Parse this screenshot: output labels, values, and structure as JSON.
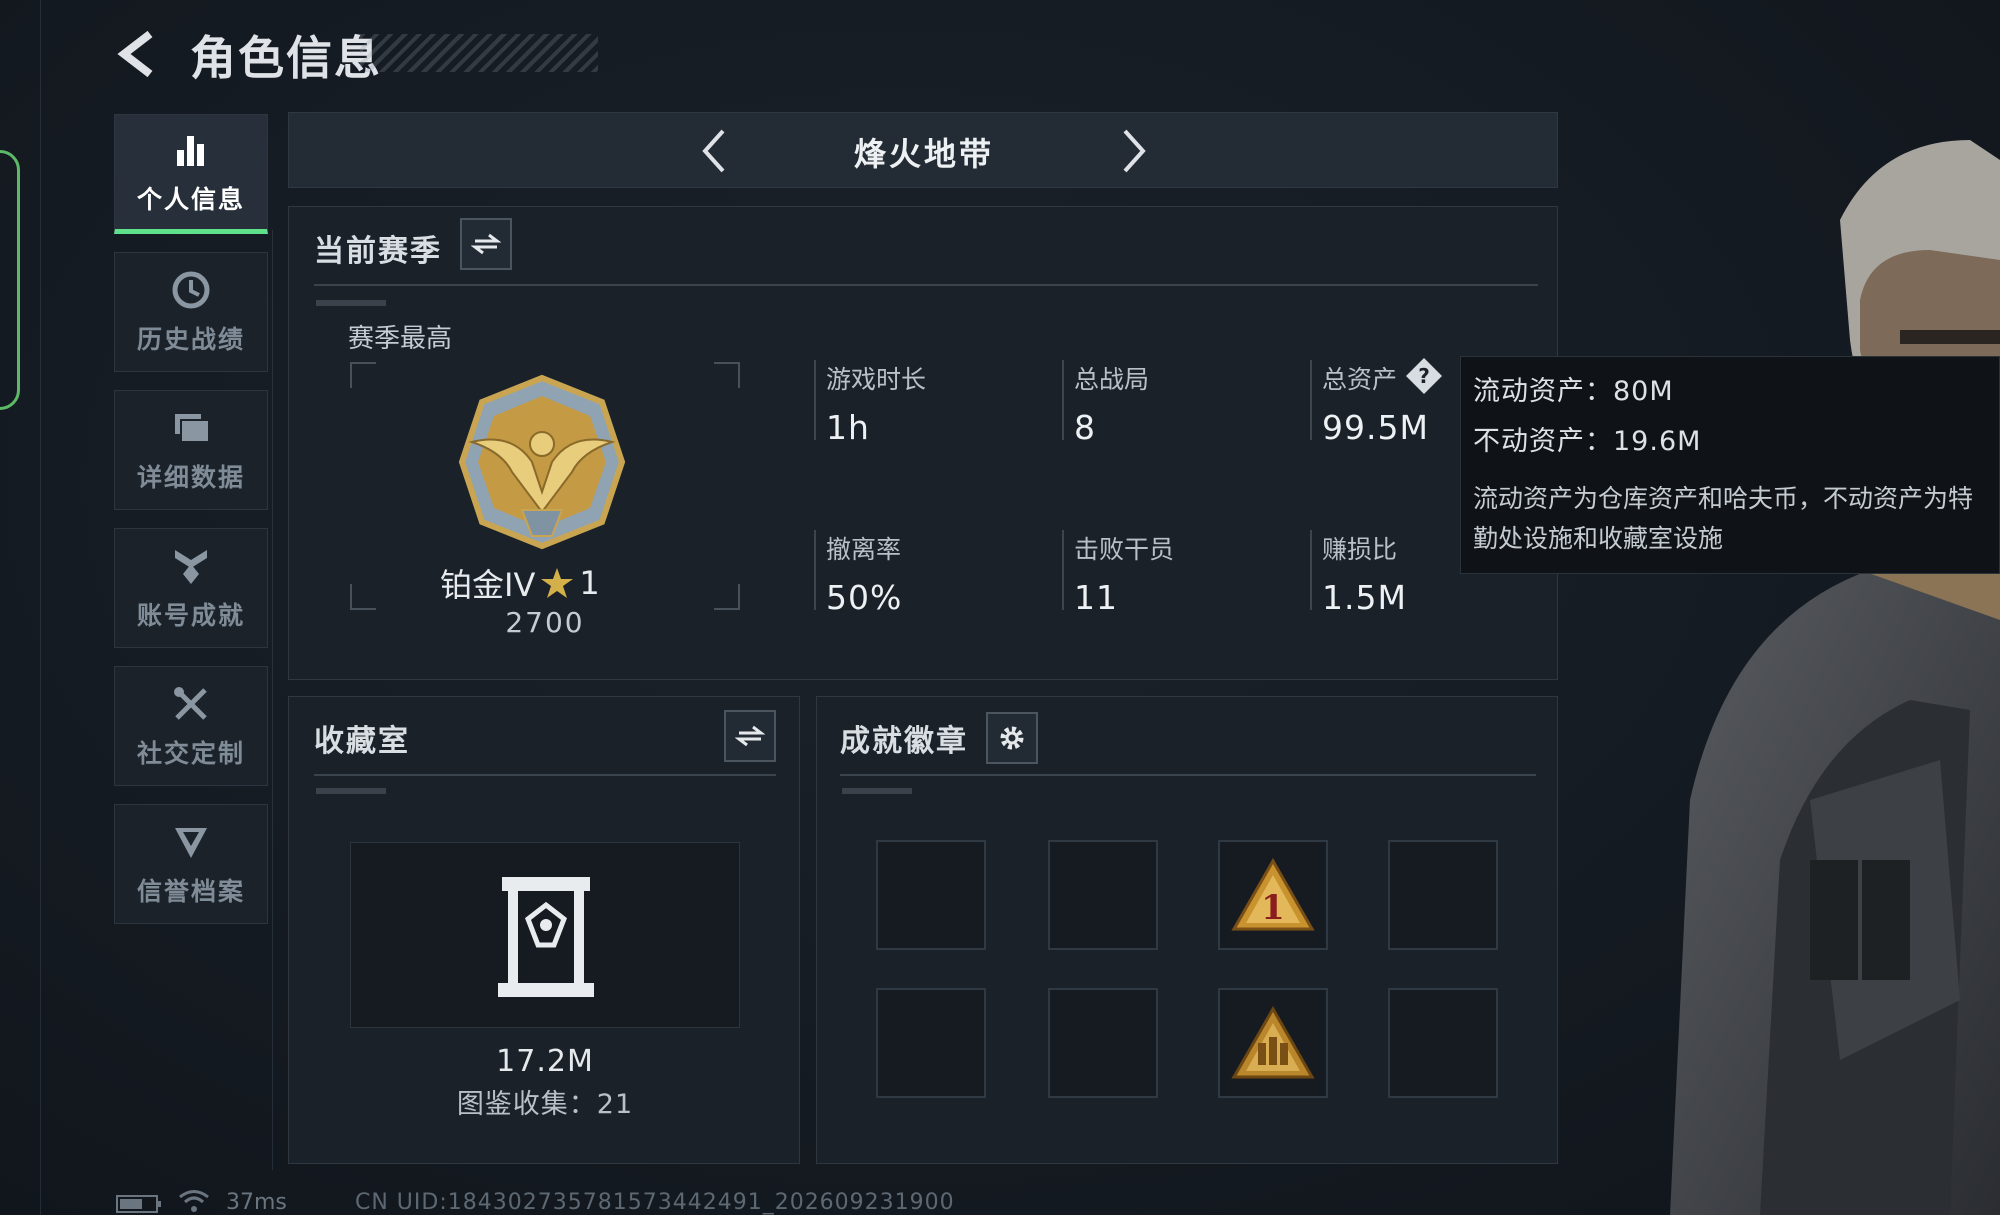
{
  "header": {
    "title": "角色信息"
  },
  "sidebar": {
    "items": [
      {
        "label": "个人信息",
        "icon": "bar-chart-icon",
        "active": true
      },
      {
        "label": "历史战绩",
        "icon": "clock-icon",
        "active": false
      },
      {
        "label": "详细数据",
        "icon": "folder-icon",
        "active": false
      },
      {
        "label": "账号成就",
        "icon": "achievement-icon",
        "active": false
      },
      {
        "label": "社交定制",
        "icon": "wrench-icon",
        "active": false
      },
      {
        "label": "信誉档案",
        "icon": "shield-icon",
        "active": false
      }
    ]
  },
  "mode_bar": {
    "title": "烽火地带"
  },
  "season": {
    "title": "当前赛季",
    "peak_label": "赛季最高",
    "rank_name": "铂金IV",
    "rank_stars": "1",
    "rank_score": "2700",
    "stats": [
      {
        "key": "游戏时长",
        "value": "1h"
      },
      {
        "key": "总战局",
        "value": "8"
      },
      {
        "key": "总资产",
        "value": "99.5M"
      },
      {
        "key": "撤离率",
        "value": "50%"
      },
      {
        "key": "击败干员",
        "value": "11"
      },
      {
        "key": "赚损比",
        "value": "1.5M"
      }
    ]
  },
  "tooltip": {
    "liquid": "流动资产：80M",
    "fixed": "不动资产：19.6M",
    "desc": "流动资产为仓库资产和哈夫币，不动资产为特勤处设施和收藏室设施"
  },
  "collection": {
    "title": "收藏室",
    "value": "17.2M",
    "count": "图鉴收集：21"
  },
  "badges": {
    "title": "成就徽章",
    "slots": [
      "empty",
      "empty",
      "rank-1-badge",
      "empty",
      "empty",
      "empty",
      "squad-badge",
      "empty"
    ]
  },
  "footer": {
    "ping": "37ms",
    "uid": "CN UID:184302735781573442491_202609231900"
  },
  "colors": {
    "accent": "#5fe08a",
    "gold": "#c8a24a"
  }
}
